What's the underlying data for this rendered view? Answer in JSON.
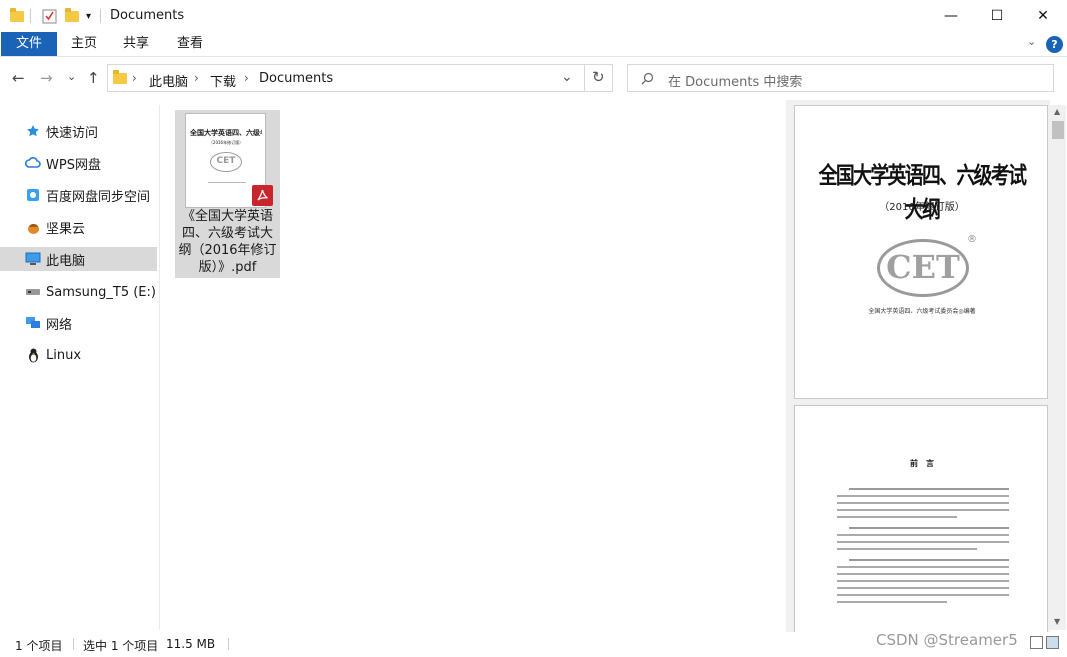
{
  "window": {
    "title": "Documents",
    "controls": {
      "minimize": "—",
      "maximize": "☐",
      "close": "✕"
    }
  },
  "ribbon": {
    "tabs": [
      {
        "label": "文件",
        "active": true
      },
      {
        "label": "主页"
      },
      {
        "label": "共享"
      },
      {
        "label": "查看"
      }
    ],
    "help_icon": "?",
    "accent": "#1a63b7"
  },
  "navigation": {
    "back": "←",
    "forward": "→",
    "recent": "⌄",
    "up": "↑",
    "breadcrumb": [
      "此电脑",
      "下载",
      "Documents"
    ],
    "dropdown": "⌄",
    "refresh": "↻",
    "search_placeholder": "在 Documents 中搜索"
  },
  "sidebar": {
    "items": [
      {
        "label": "快速访问",
        "icon": "star-icon"
      },
      {
        "label": "WPS网盘",
        "icon": "cloud-icon"
      },
      {
        "label": "百度网盘同步空间",
        "icon": "baidu-icon"
      },
      {
        "label": "坚果云",
        "icon": "nut-icon"
      },
      {
        "label": "此电脑",
        "icon": "computer-icon",
        "selected": true
      },
      {
        "label": "Samsung_T5 (E:)",
        "icon": "drive-icon"
      },
      {
        "label": "网络",
        "icon": "network-icon"
      },
      {
        "label": "Linux",
        "icon": "penguin-icon"
      }
    ]
  },
  "files": [
    {
      "name_line1": "《全国大学英语",
      "name_line2": "四、六级考试大",
      "name_line3": "纲（2016年修订",
      "name_line4": "版）》.pdf",
      "thumb_title": "全国大学英语四、六级考试大纲",
      "thumb_sub": "（2016年修订版）",
      "thumb_logo": "CET"
    }
  ],
  "preview": {
    "page1": {
      "title": "全国大学英语四、六级考试大纲",
      "subtitle": "（2016年修订版）",
      "logo": "CET",
      "registered": "®",
      "publisher": "全国大学英语四、六级考试委员会◎编著"
    },
    "page2": {
      "heading": "前　言"
    }
  },
  "status": {
    "count": "1 个项目",
    "selection": "选中 1 个项目",
    "size": "11.5 MB"
  },
  "watermark": "CSDN @Streamer5"
}
